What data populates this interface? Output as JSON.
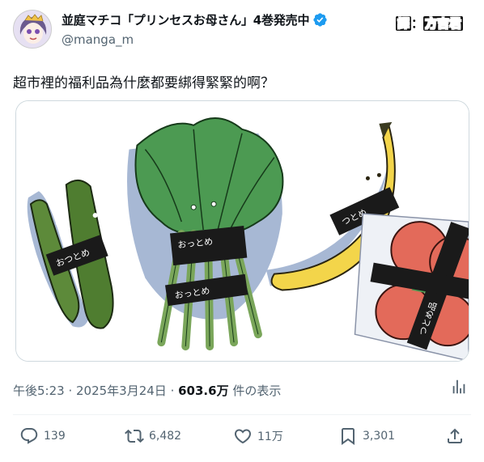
{
  "author": {
    "display_name": "並庭マチコ「プリンセスお母さん」4巻発売中",
    "handle": "@manga_m",
    "verified": true
  },
  "translator_credit": {
    "prefix": "譯",
    "separator": "：",
    "name": "方吉君"
  },
  "tweet": {
    "text": "超市裡的福利品為什麼都要綁得緊緊的啊？"
  },
  "media": {
    "labels": {
      "cucumber_tape": "おつとめ",
      "spinach_tape_top": "おっとめ",
      "spinach_tape_bottom": "おっとめ",
      "banana_tape": "つとめ",
      "tomato_tape": "つとめ品"
    }
  },
  "meta": {
    "time": "午後5:23",
    "separator": " · ",
    "date": "2025年3月24日",
    "views_count": "603.6万",
    "views_label": " 件の表示"
  },
  "actions": {
    "replies": "139",
    "reposts": "6,482",
    "likes": "11万",
    "bookmarks": "3,301"
  }
}
